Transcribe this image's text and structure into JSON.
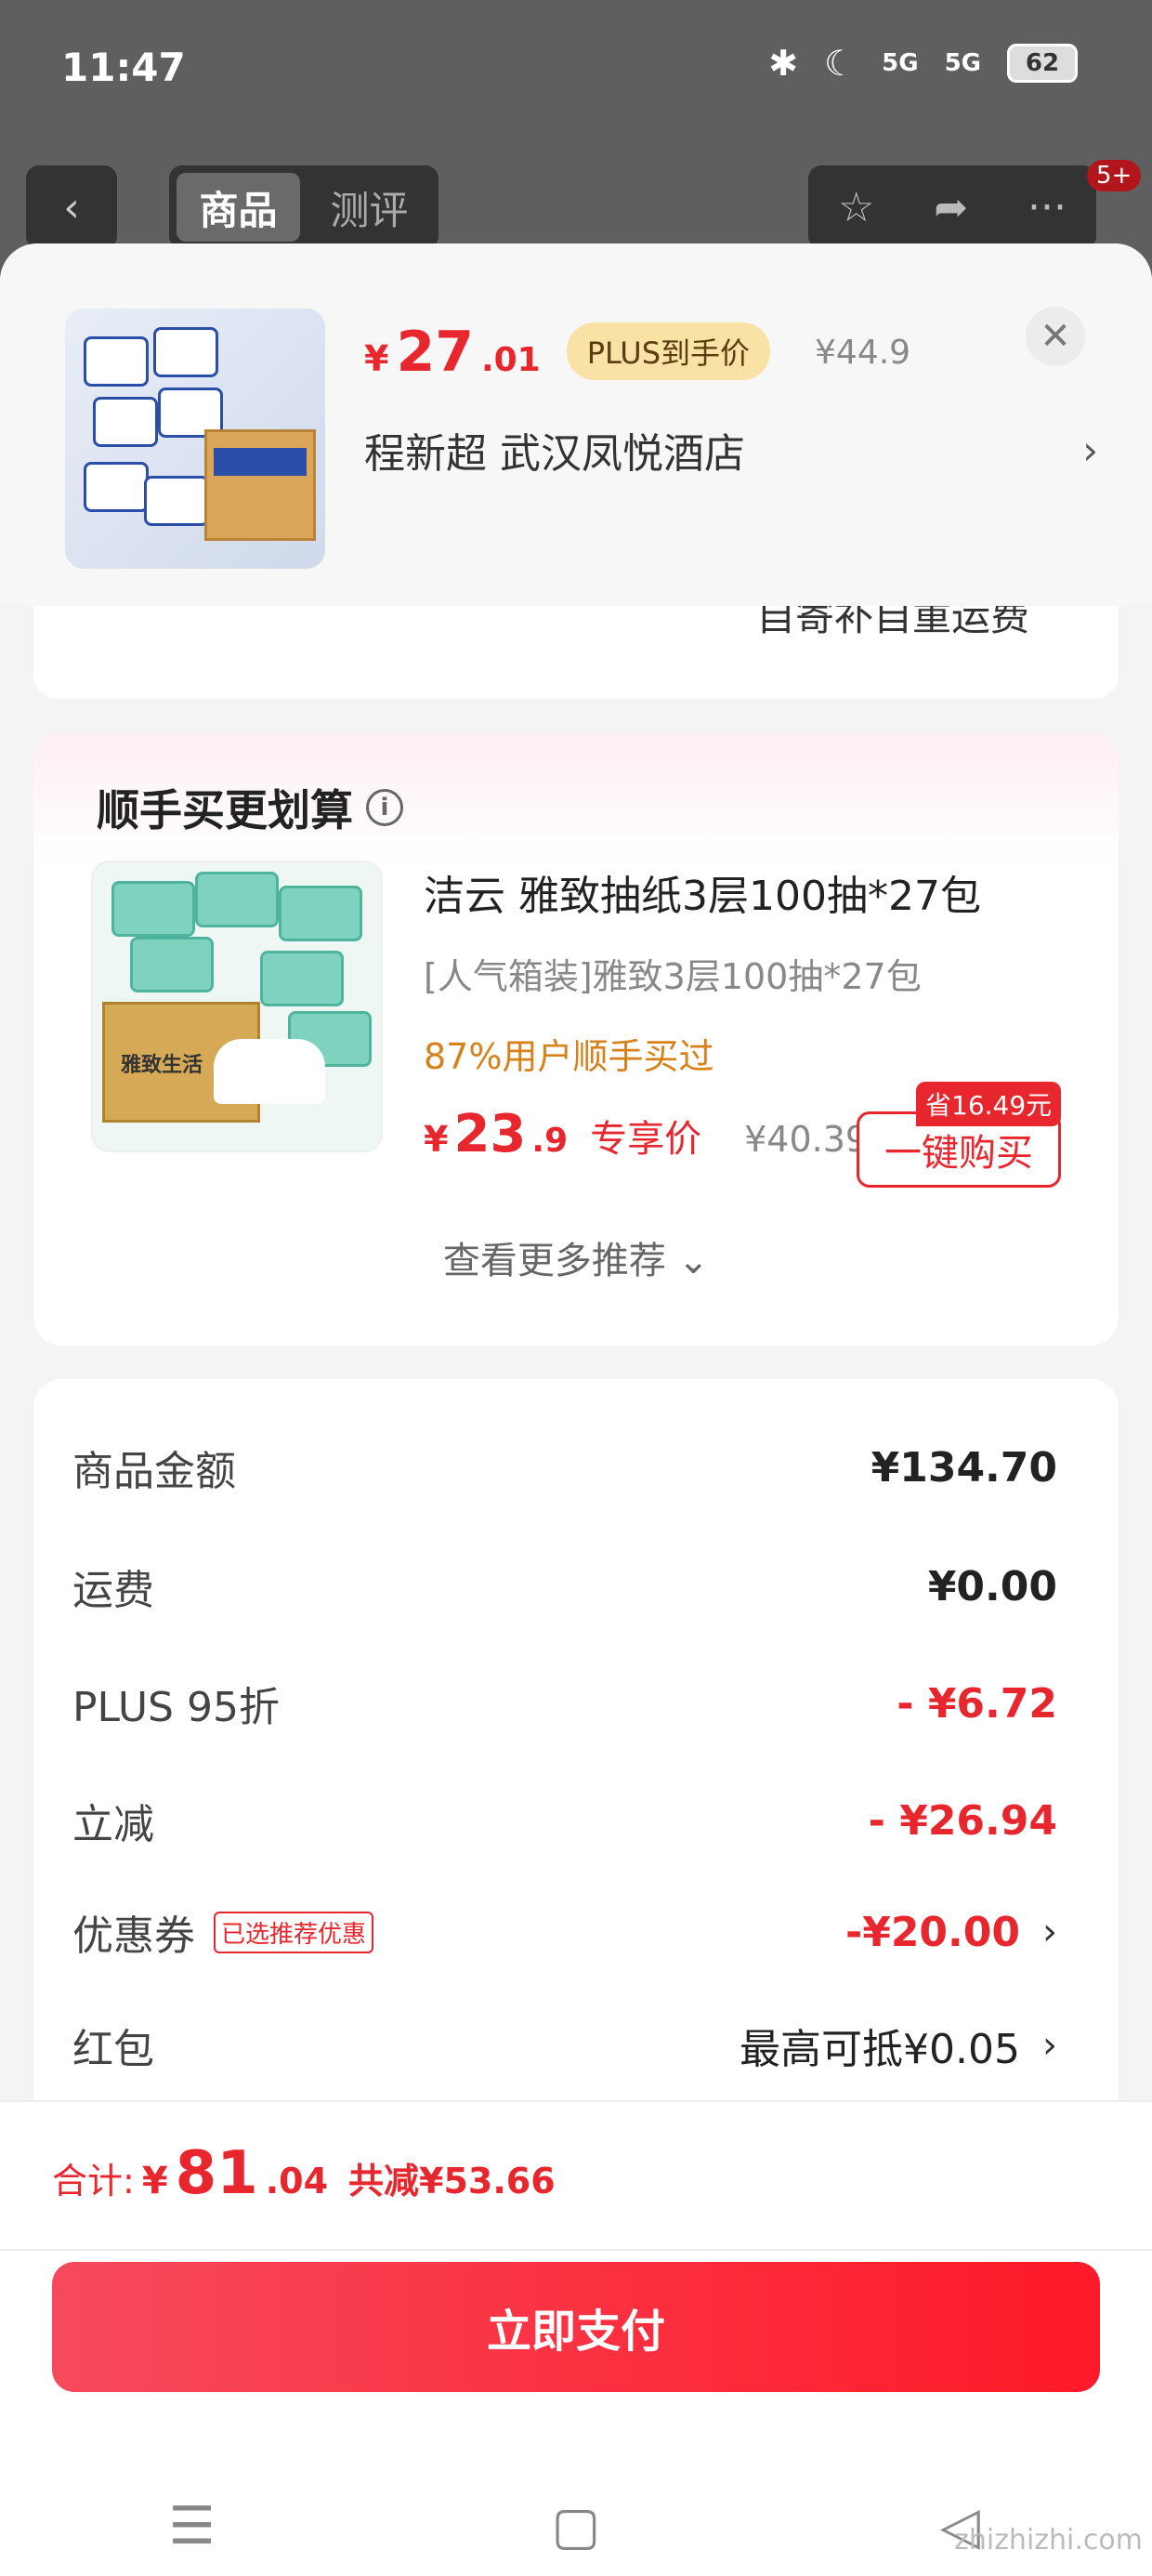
{
  "status": {
    "time": "11:47",
    "signal1": "5G",
    "signal2": "5G",
    "battery": "62"
  },
  "background_nav": {
    "tab_goods": "商品",
    "tab_review": "测评",
    "badge": "5+"
  },
  "product": {
    "price_currency": "¥",
    "price_int": "27",
    "price_dec": ".01",
    "plus_badge": "PLUS到手价",
    "orig_price": "¥44.9",
    "spec": "程新超  武汉凤悦酒店"
  },
  "cut_card": {
    "text": "自寄补自重运费"
  },
  "recommend": {
    "title": "顺手买更划算",
    "name": "洁云 雅致抽纸3层100抽*27包",
    "sub": "[人气箱装]雅致3层100抽*27包",
    "social": "87%用户顺手买过",
    "price_currency": "¥",
    "price_int": "23",
    "price_dec": ".9",
    "price_tag": "专享价",
    "orig_price": "¥40.39",
    "save_badge": "省16.49元",
    "buy_label": "一键购买",
    "more_label": "查看更多推荐 ⌄",
    "thumb_text": "雅致生活"
  },
  "summary": {
    "rows": [
      {
        "label": "商品金额",
        "value": "¥134.70"
      },
      {
        "label": "运费",
        "value": "¥0.00"
      },
      {
        "label": "PLUS 95折",
        "value": "- ¥6.72"
      },
      {
        "label": "立减",
        "value": "- ¥26.94"
      },
      {
        "label": "优惠券",
        "tag": "已选推荐优惠",
        "value": "-¥20.00"
      },
      {
        "label": "红包",
        "value": "最高可抵¥0.05"
      }
    ]
  },
  "total": {
    "label": "合计:",
    "currency": "¥",
    "int": "81",
    "dec": ".04",
    "saved": "共减¥53.66"
  },
  "pay_button": "立即支付",
  "watermark": "zhizhizhi.com",
  "colors": {
    "accent": "#e8262d",
    "plus_badge_bg": "#f8e2a6",
    "social_orange": "#d7811b"
  }
}
